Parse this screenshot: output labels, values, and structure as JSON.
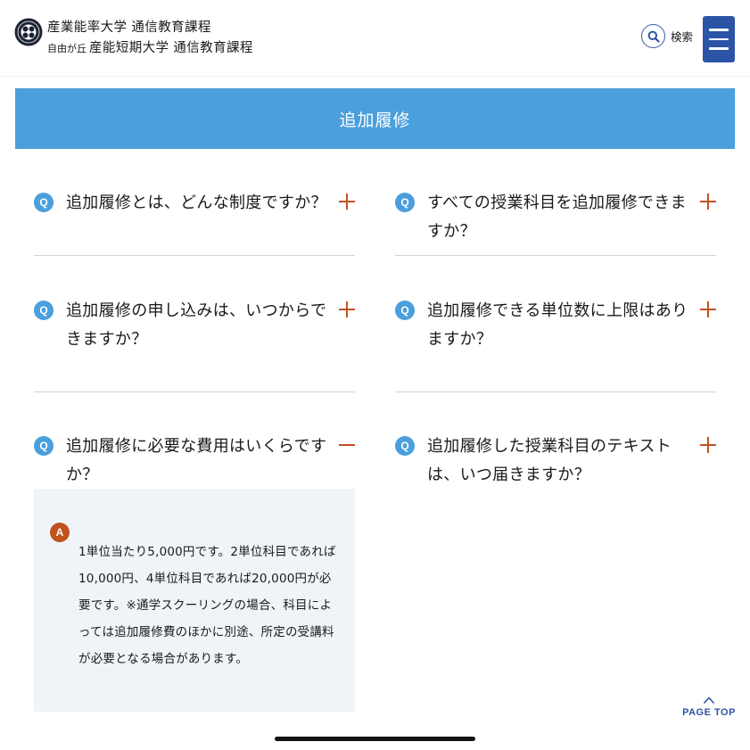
{
  "header": {
    "brand_line1": "産業能率大学 通信教育課程",
    "brand_line2_small": "自由が丘",
    "brand_line2_main": "産能短期大学 通信教育課程",
    "search_label": "検索"
  },
  "section": {
    "title": "追加履修"
  },
  "faq": {
    "q_badge": "Q",
    "items": [
      {
        "question": "追加履修とは、どんな制度ですか？",
        "expanded": false
      },
      {
        "question": "すべての授業科目を追加履修できますか？",
        "expanded": false
      },
      {
        "question": "追加履修の申し込みは、いつからできますか？",
        "expanded": false
      },
      {
        "question": "追加履修できる単位数に上限はありますか？",
        "expanded": false
      },
      {
        "question": "追加履修に必要な費用はいくらですか？",
        "expanded": true
      },
      {
        "question": "追加履修した授業科目のテキストは、いつ届きますか？",
        "expanded": false
      }
    ]
  },
  "answer": {
    "a_badge": "A",
    "text": "1単位当たり5,000円です。2単位科目であれば10,000円、4単位科目であれば20,000円が必要です。※通学スクーリングの場合、科目によっては追加履修費のほかに別途、所定の受講料が必要となる場合があります。"
  },
  "page_top": {
    "label": "PAGE TOP"
  },
  "colors": {
    "accent_blue": "#4a9fdc",
    "navy": "#2c54a6",
    "toggle_orange": "#c0521e",
    "answer_bg": "#f0f4f8"
  }
}
